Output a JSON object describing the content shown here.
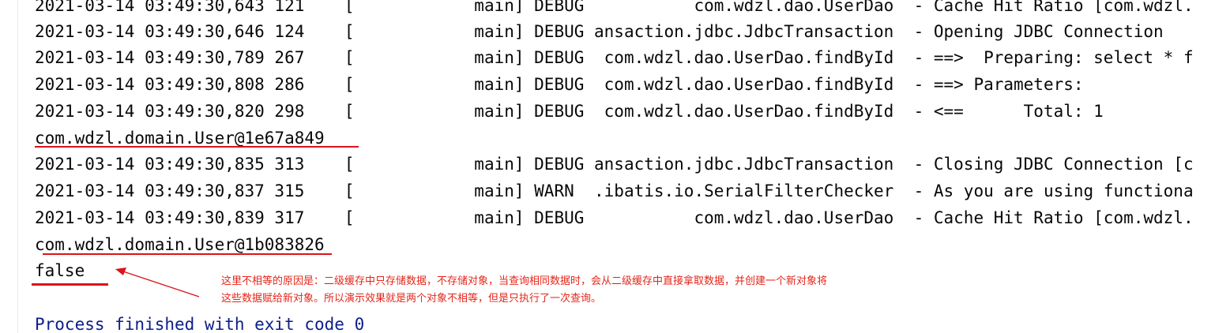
{
  "console": {
    "lines": [
      "2021-03-14 03:49:30,643 121    [            main] DEBUG           com.wdzl.dao.UserDao  - Cache Hit Ratio [com.wdzl.",
      "2021-03-14 03:49:30,646 124    [            main] DEBUG ansaction.jdbc.JdbcTransaction  - Opening JDBC Connection",
      "2021-03-14 03:49:30,789 267    [            main] DEBUG  com.wdzl.dao.UserDao.findById  - ==>  Preparing: select * f",
      "2021-03-14 03:49:30,808 286    [            main] DEBUG  com.wdzl.dao.UserDao.findById  - ==> Parameters:",
      "2021-03-14 03:49:30,820 298    [            main] DEBUG  com.wdzl.dao.UserDao.findById  - <==      Total: 1",
      "com.wdzl.domain.User@1e67a849",
      "2021-03-14 03:49:30,835 313    [            main] DEBUG ansaction.jdbc.JdbcTransaction  - Closing JDBC Connection [c",
      "2021-03-14 03:49:30,837 315    [            main] WARN  .ibatis.io.SerialFilterChecker  - As you are using functiona",
      "2021-03-14 03:49:30,839 317    [            main] DEBUG           com.wdzl.dao.UserDao  - Cache Hit Ratio [com.wdzl.",
      "com.wdzl.domain.User@1b083826",
      "false"
    ],
    "process_finished": "Process finished with exit code 0"
  },
  "annotation": {
    "line1": "这里不相等的原因是：二级缓存中只存储数据，不存储对象，当查询相同数据时，会从二级缓存中直接拿取数据，并创建一个新对象将",
    "line2": "这些数据赋给新对象。所以演示效果就是两个对象不相等，但是只执行了一次查询。"
  },
  "colors": {
    "text": "#080808",
    "process_text": "#0b1e8a",
    "annotation": "#e4261a"
  }
}
